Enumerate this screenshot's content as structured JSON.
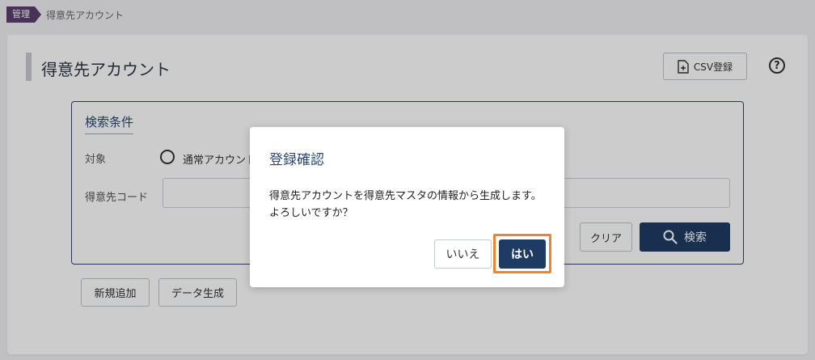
{
  "breadcrumb": {
    "section": "管理",
    "current": "得意先アカウント"
  },
  "page": {
    "title": "得意先アカウント",
    "csv_button": "CSV登録",
    "help_icon": "?"
  },
  "search": {
    "title": "検索条件",
    "target_label": "対象",
    "radio_option": "通常アカウント",
    "code_label": "得意先コード",
    "code_value": "",
    "clear_button": "クリア",
    "search_button": "検索"
  },
  "actions": {
    "new_button": "新規追加",
    "generate_button": "データ生成"
  },
  "dialog": {
    "title": "登録確認",
    "message_line1": "得意先アカウントを得意先マスタの情報から生成します。",
    "message_line2": "よろしいですか？",
    "no_button": "いいえ",
    "yes_button": "はい"
  },
  "colors": {
    "primary": "#1e3b63",
    "breadcrumb_tag": "#5b3f6e",
    "focus_outline": "#e88530"
  }
}
